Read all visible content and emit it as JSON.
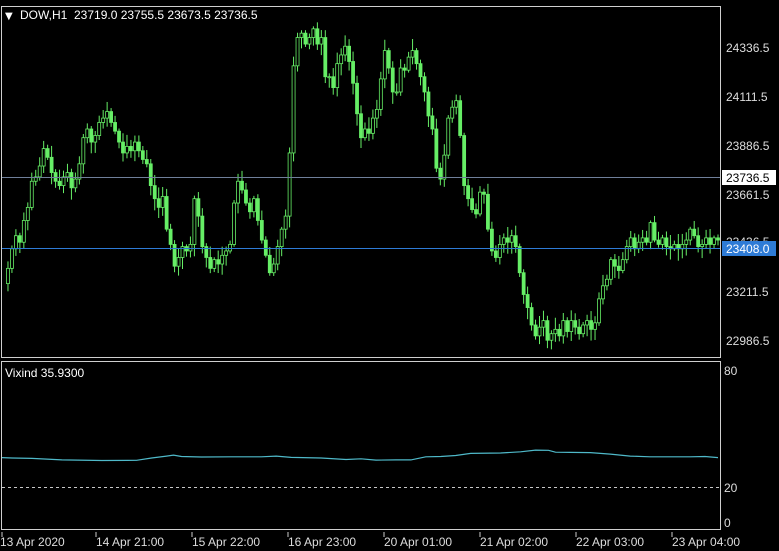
{
  "main_panel": {
    "symbol_title": "DOW,H1",
    "ohlc": "23719.0 23755.5 23673.5 23736.5",
    "price_ticks": [
      "24336.5",
      "24111.5",
      "23886.5",
      "23661.5",
      "23436.5",
      "23211.5",
      "22986.5"
    ],
    "current_price_label": "23736.5",
    "bid_line_label": "23408.0",
    "colors": {
      "candle": "#66ee66",
      "grid_line": "#6f7f9a",
      "bid_line": "#2e7bd6",
      "panel_border": "#cfcfcf",
      "background": "#000000"
    }
  },
  "indicator_panel": {
    "title": "Vixind 35.9300",
    "ticks": [
      "80",
      "20",
      "0"
    ],
    "colors": {
      "line": "#4fb9c9",
      "level_line": "#c8c8c8"
    }
  },
  "time_axis": {
    "labels": [
      "13 Apr 2020",
      "14 Apr 21:00",
      "15 Apr 22:00",
      "16 Apr 23:00",
      "20 Apr 01:00",
      "21 Apr 02:00",
      "22 Apr 03:00",
      "23 Apr 04:00"
    ]
  },
  "chart_data": [
    {
      "type": "candlestick",
      "title": "DOW,H1",
      "ylim": [
        22900,
        24450
      ],
      "yticks": [
        24336.5,
        24111.5,
        23886.5,
        23661.5,
        23436.5,
        23211.5,
        22986.5
      ],
      "current_price": 23736.5,
      "bid_price": 23408.0,
      "close_path": [
        [
          0,
          23250
        ],
        [
          4,
          23320
        ],
        [
          8,
          23410
        ],
        [
          12,
          23470
        ],
        [
          16,
          23440
        ],
        [
          20,
          23540
        ],
        [
          24,
          23600
        ],
        [
          28,
          23720
        ],
        [
          32,
          23740
        ],
        [
          36,
          23790
        ],
        [
          40,
          23870
        ],
        [
          44,
          23830
        ],
        [
          48,
          23760
        ],
        [
          52,
          23720
        ],
        [
          56,
          23700
        ],
        [
          60,
          23740
        ],
        [
          64,
          23760
        ],
        [
          68,
          23690
        ],
        [
          72,
          23730
        ],
        [
          76,
          23800
        ],
        [
          80,
          23920
        ],
        [
          84,
          23960
        ],
        [
          88,
          23900
        ],
        [
          92,
          23930
        ],
        [
          96,
          23990
        ],
        [
          100,
          24010
        ],
        [
          104,
          24040
        ],
        [
          108,
          23990
        ],
        [
          112,
          23950
        ],
        [
          116,
          23900
        ],
        [
          120,
          23850
        ],
        [
          124,
          23880
        ],
        [
          128,
          23860
        ],
        [
          132,
          23900
        ],
        [
          136,
          23860
        ],
        [
          140,
          23820
        ],
        [
          144,
          23800
        ],
        [
          148,
          23700
        ],
        [
          152,
          23640
        ],
        [
          156,
          23600
        ],
        [
          160,
          23650
        ],
        [
          164,
          23500
        ],
        [
          168,
          23430
        ],
        [
          172,
          23330
        ],
        [
          176,
          23370
        ],
        [
          180,
          23420
        ],
        [
          184,
          23400
        ],
        [
          188,
          23430
        ],
        [
          192,
          23640
        ],
        [
          196,
          23560
        ],
        [
          200,
          23420
        ],
        [
          204,
          23370
        ],
        [
          208,
          23320
        ],
        [
          212,
          23360
        ],
        [
          216,
          23340
        ],
        [
          220,
          23380
        ],
        [
          224,
          23400
        ],
        [
          228,
          23430
        ],
        [
          232,
          23620
        ],
        [
          236,
          23720
        ],
        [
          240,
          23680
        ],
        [
          244,
          23620
        ],
        [
          248,
          23580
        ],
        [
          252,
          23640
        ],
        [
          256,
          23540
        ],
        [
          260,
          23450
        ],
        [
          264,
          23380
        ],
        [
          268,
          23300
        ],
        [
          272,
          23340
        ],
        [
          276,
          23420
        ],
        [
          280,
          23500
        ],
        [
          284,
          23560
        ],
        [
          288,
          23850
        ],
        [
          292,
          24250
        ],
        [
          296,
          24380
        ],
        [
          300,
          24400
        ],
        [
          304,
          24350
        ],
        [
          308,
          24380
        ],
        [
          312,
          24420
        ],
        [
          316,
          24350
        ],
        [
          320,
          24380
        ],
        [
          324,
          24200
        ],
        [
          328,
          24200
        ],
        [
          332,
          24150
        ],
        [
          336,
          24260
        ],
        [
          340,
          24300
        ],
        [
          344,
          24340
        ],
        [
          348,
          24270
        ],
        [
          352,
          24170
        ],
        [
          356,
          24030
        ],
        [
          360,
          23920
        ],
        [
          364,
          23960
        ],
        [
          368,
          23940
        ],
        [
          372,
          24010
        ],
        [
          376,
          24050
        ],
        [
          380,
          24190
        ],
        [
          384,
          24320
        ],
        [
          388,
          24240
        ],
        [
          392,
          24130
        ],
        [
          396,
          24130
        ],
        [
          400,
          24240
        ],
        [
          404,
          24230
        ],
        [
          408,
          24290
        ],
        [
          412,
          24320
        ],
        [
          416,
          24260
        ],
        [
          420,
          24200
        ],
        [
          424,
          24130
        ],
        [
          428,
          24020
        ],
        [
          432,
          23960
        ],
        [
          436,
          23780
        ],
        [
          440,
          23730
        ],
        [
          444,
          23840
        ],
        [
          448,
          24010
        ],
        [
          452,
          24060
        ],
        [
          456,
          24090
        ],
        [
          460,
          23930
        ],
        [
          464,
          23700
        ],
        [
          468,
          23640
        ],
        [
          472,
          23590
        ],
        [
          476,
          23570
        ],
        [
          480,
          23670
        ],
        [
          484,
          23660
        ],
        [
          488,
          23500
        ],
        [
          492,
          23400
        ],
        [
          496,
          23370
        ],
        [
          500,
          23430
        ],
        [
          504,
          23460
        ],
        [
          508,
          23440
        ],
        [
          512,
          23470
        ],
        [
          516,
          23420
        ],
        [
          520,
          23300
        ],
        [
          524,
          23200
        ],
        [
          528,
          23140
        ],
        [
          532,
          23060
        ],
        [
          536,
          23010
        ],
        [
          540,
          23050
        ],
        [
          544,
          23080
        ],
        [
          548,
          22990
        ],
        [
          552,
          23020
        ],
        [
          556,
          23040
        ],
        [
          560,
          23010
        ],
        [
          564,
          23080
        ],
        [
          568,
          23030
        ],
        [
          572,
          23080
        ],
        [
          576,
          23050
        ],
        [
          580,
          23020
        ],
        [
          584,
          23060
        ],
        [
          588,
          23080
        ],
        [
          592,
          23040
        ],
        [
          596,
          23070
        ],
        [
          600,
          23180
        ],
        [
          604,
          23240
        ],
        [
          608,
          23270
        ],
        [
          612,
          23360
        ],
        [
          616,
          23330
        ],
        [
          620,
          23310
        ],
        [
          624,
          23360
        ],
        [
          628,
          23420
        ],
        [
          632,
          23460
        ],
        [
          636,
          23410
        ],
        [
          640,
          23440
        ],
        [
          644,
          23460
        ],
        [
          648,
          23440
        ],
        [
          652,
          23530
        ],
        [
          656,
          23450
        ],
        [
          660,
          23430
        ],
        [
          664,
          23460
        ],
        [
          668,
          23420
        ],
        [
          672,
          23410
        ],
        [
          676,
          23430
        ],
        [
          680,
          23410
        ],
        [
          684,
          23430
        ],
        [
          688,
          23450
        ],
        [
          692,
          23500
        ],
        [
          696,
          23470
        ],
        [
          700,
          23420
        ],
        [
          704,
          23430
        ],
        [
          708,
          23460
        ],
        [
          712,
          23430
        ],
        [
          716,
          23460
        ],
        [
          720,
          23450
        ]
      ]
    },
    {
      "type": "line",
      "title": "Vixind 35.9300",
      "ylim": [
        0,
        80
      ],
      "yticks": [
        80,
        20,
        0
      ],
      "level": 20,
      "points": [
        [
          0,
          35.2
        ],
        [
          10,
          35
        ],
        [
          30,
          34.8
        ],
        [
          60,
          34.0
        ],
        [
          100,
          33.7
        ],
        [
          135,
          33.8
        ],
        [
          150,
          35.0
        ],
        [
          165,
          36.0
        ],
        [
          172,
          36.5
        ],
        [
          180,
          35.8
        ],
        [
          200,
          35.5
        ],
        [
          230,
          35.6
        ],
        [
          260,
          35.6
        ],
        [
          275,
          36.0
        ],
        [
          290,
          35.3
        ],
        [
          320,
          35.0
        ],
        [
          345,
          34.2
        ],
        [
          360,
          34.6
        ],
        [
          375,
          33.9
        ],
        [
          395,
          34.0
        ],
        [
          410,
          34.0
        ],
        [
          425,
          35.6
        ],
        [
          440,
          35.8
        ],
        [
          455,
          36.3
        ],
        [
          470,
          37.4
        ],
        [
          500,
          37.6
        ],
        [
          520,
          38.2
        ],
        [
          535,
          39.1
        ],
        [
          548,
          39.0
        ],
        [
          555,
          38.0
        ],
        [
          570,
          37.9
        ],
        [
          590,
          37.8
        ],
        [
          610,
          37.0
        ],
        [
          630,
          36.0
        ],
        [
          650,
          35.6
        ],
        [
          670,
          35.6
        ],
        [
          690,
          35.6
        ],
        [
          705,
          35.8
        ],
        [
          718,
          35.2
        ]
      ]
    }
  ]
}
